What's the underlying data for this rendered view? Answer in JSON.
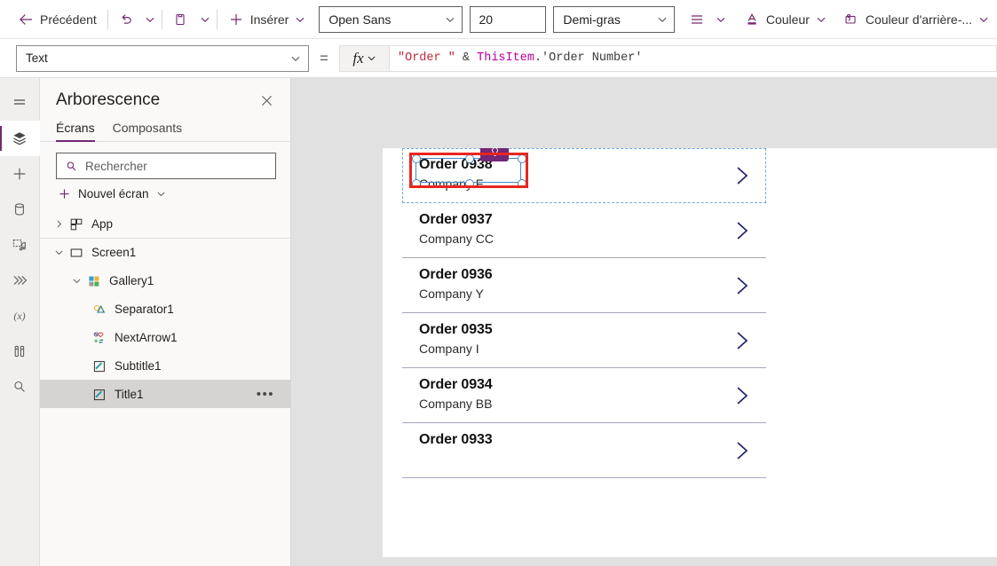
{
  "commandbar": {
    "back": {
      "label": "Précédent",
      "icon": "arrow-left-icon"
    },
    "undo": {
      "icon": "undo-icon"
    },
    "undo_chevron": {
      "icon": "chevron-down-icon"
    },
    "paste": {
      "icon": "clipboard-icon"
    },
    "paste_chevron": {
      "icon": "chevron-down-icon"
    },
    "insert": {
      "label": "Insérer",
      "icon": "plus-icon",
      "chevron": "chevron-down-icon"
    },
    "font_family": {
      "value": "Open Sans",
      "chevron": "chevron-down-icon"
    },
    "font_size": {
      "value": "20"
    },
    "font_weight": {
      "value": "Demi-gras",
      "chevron": "chevron-down-icon"
    },
    "align": {
      "icon": "align-lines-icon",
      "chevron": "chevron-down-icon"
    },
    "color": {
      "label": "Couleur",
      "icon": "font-color-icon",
      "chevron": "chevron-down-icon"
    },
    "fill": {
      "label": "Couleur d'arrière-...",
      "icon": "fill-color-icon",
      "chevron": "chevron-down-icon"
    }
  },
  "formulabar": {
    "property": {
      "value": "Text",
      "chevron": "chevron-down-icon"
    },
    "equals": "=",
    "fx": {
      "glyph": "fx",
      "chevron": "chevron-down-icon"
    },
    "formula": {
      "full": "\"Order \" & ThisItem.'Order Number'",
      "tokens": {
        "string": "\"Order \"",
        "amp": " & ",
        "ident": "ThisItem",
        "dot": ".",
        "field": "'Order Number'"
      }
    }
  },
  "rail": {
    "items": [
      {
        "name": "hamburger-icon",
        "title": "Menu"
      },
      {
        "name": "layers-icon",
        "title": "Arborescence",
        "active": true
      },
      {
        "name": "plus-icon",
        "title": "Insérer"
      },
      {
        "name": "database-icon",
        "title": "Données"
      },
      {
        "name": "media-icon",
        "title": "Multimédia"
      },
      {
        "name": "power-automate-icon",
        "title": "Power Automate"
      },
      {
        "name": "variables-icon",
        "title": "Variables"
      },
      {
        "name": "tools-icon",
        "title": "Outils"
      },
      {
        "name": "search-icon",
        "title": "Rechercher"
      }
    ]
  },
  "treepanel": {
    "title": "Arborescence",
    "close_icon": "close-icon",
    "tabs": [
      {
        "label": "Écrans",
        "selected": true
      },
      {
        "label": "Composants",
        "selected": false
      }
    ],
    "search": {
      "placeholder": "Rechercher",
      "icon": "search-icon",
      "value": ""
    },
    "new_screen": {
      "label": "Nouvel écran",
      "icon": "plus-icon",
      "chevron": "chevron-down-icon"
    },
    "nodes": [
      {
        "label": "App",
        "depth": 0,
        "twisty": "chevron-right-icon",
        "icon": "app-icon",
        "selected": false,
        "topline": false,
        "dots": false
      },
      {
        "label": "Screen1",
        "depth": 0,
        "twisty": "chevron-down-icon",
        "icon": "screen-icon",
        "selected": false,
        "topline": true,
        "dots": false
      },
      {
        "label": "Gallery1",
        "depth": 1,
        "twisty": "chevron-down-icon",
        "icon": "gallery-icon",
        "selected": false,
        "topline": false,
        "dots": false
      },
      {
        "label": "Separator1",
        "depth": 2,
        "twisty": "",
        "icon": "shape-icon",
        "selected": false,
        "topline": false,
        "dots": false
      },
      {
        "label": "NextArrow1",
        "depth": 2,
        "twisty": "",
        "icon": "icon-icon",
        "selected": false,
        "topline": false,
        "dots": false
      },
      {
        "label": "Subtitle1",
        "depth": 2,
        "twisty": "",
        "icon": "label-icon",
        "selected": false,
        "topline": false,
        "dots": false
      },
      {
        "label": "Title1",
        "depth": 2,
        "twisty": "",
        "icon": "label-icon",
        "selected": true,
        "topline": false,
        "dots": true
      }
    ],
    "overflow_dots": "•••"
  },
  "canvas": {
    "selected_control": "Title1",
    "badge": {
      "icon": "lightbulb-icon",
      "color": "#742774"
    },
    "selection_color": "#4a86c8",
    "highlight_color": "#e8261e",
    "gallery": {
      "name": "Gallery1",
      "arrow_icon": "chevron-right-icon",
      "arrow_color": "#20216b",
      "items": [
        {
          "title": "Order 0938",
          "subtitle": "Company F",
          "selected_template": true
        },
        {
          "title": "Order 0937",
          "subtitle": "Company CC",
          "selected_template": false
        },
        {
          "title": "Order 0936",
          "subtitle": "Company Y",
          "selected_template": false
        },
        {
          "title": "Order 0935",
          "subtitle": "Company I",
          "selected_template": false
        },
        {
          "title": "Order 0934",
          "subtitle": "Company BB",
          "selected_template": false
        },
        {
          "title": "Order 0933",
          "subtitle": "",
          "selected_template": false
        }
      ]
    }
  }
}
